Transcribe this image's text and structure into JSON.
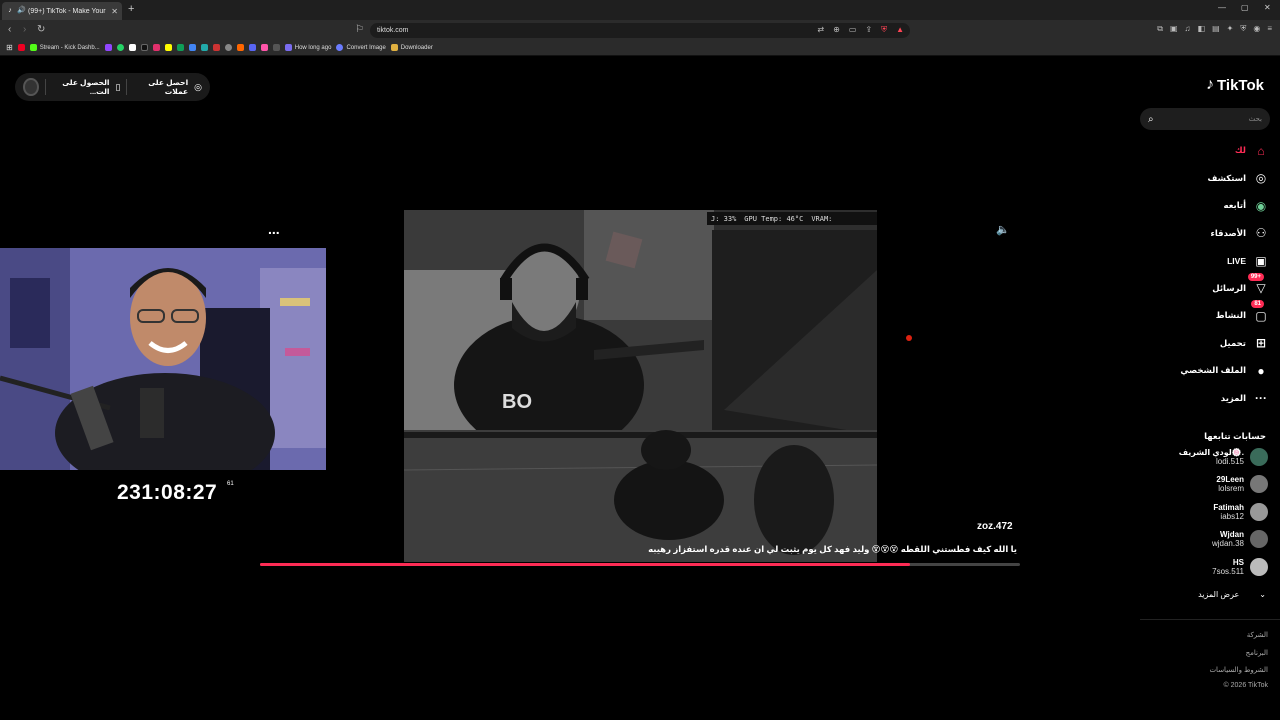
{
  "browser": {
    "tab_title": "(99+) TikTok - Make Your Day",
    "new_tab": "+",
    "close_tab": "✕",
    "url": "tiktok.com",
    "bookmarks": [
      {
        "label": "Stream - Kick Dashb...",
        "color": "#53fc18"
      },
      {
        "label": "How long ago",
        "color": "#7a6cf0"
      },
      {
        "label": "Convert Image",
        "color": "#6b7cff"
      },
      {
        "label": "Downloader",
        "color": "#e0b040"
      }
    ]
  },
  "get_app": {
    "coins": "احصل على عملات",
    "app": "الحصول على الت..."
  },
  "sidebar": {
    "logo": "TikTok",
    "search_placeholder": "بحث",
    "nav": [
      {
        "label": "لك",
        "icon": "home-icon",
        "active": true
      },
      {
        "label": "استكشف",
        "icon": "compass-icon"
      },
      {
        "label": "أتابعه",
        "icon": "following-avatar-icon"
      },
      {
        "label": "الأصدقاء",
        "icon": "friends-icon"
      },
      {
        "label": "LIVE",
        "icon": "live-icon"
      },
      {
        "label": "الرسائل",
        "icon": "messages-icon",
        "badge": "99+"
      },
      {
        "label": "النشاط",
        "icon": "activity-icon",
        "badge": "81"
      },
      {
        "label": "تحميل",
        "icon": "upload-icon"
      },
      {
        "label": "الملف الشخصي",
        "icon": "profile-icon"
      },
      {
        "label": "المزيد",
        "icon": "more-icon"
      }
    ],
    "following_heading": "حسابات تتابعها",
    "accounts": [
      {
        "display": "لودي الشريف🍥.",
        "user": "lodi.515"
      },
      {
        "display": "29Leen",
        "user": "lolsrem"
      },
      {
        "display": "Fatimah",
        "user": "iabs12"
      },
      {
        "display": "Wjdan",
        "user": "wjdan.38"
      },
      {
        "display": "HS",
        "user": "7sos.511"
      }
    ],
    "see_more": "عرض المزيد",
    "footer": [
      "الشركة",
      "البرنامج",
      "الشروط والسياسات",
      "© 2026 TikTok"
    ]
  },
  "video": {
    "gpu_overlay": [
      "J: 33%",
      "GPU Temp: 46°C",
      "VRAM:"
    ],
    "timer": "231:08:27",
    "timer_sup": "61",
    "author": "zoz.472",
    "caption": "يا الله كيف فطستني اللقطه 😵😵😵 وليد فهد كل يوم يثبت لي ان عنده قدره استفزاز رهيبه",
    "progress": 0.855,
    "more": "..."
  }
}
